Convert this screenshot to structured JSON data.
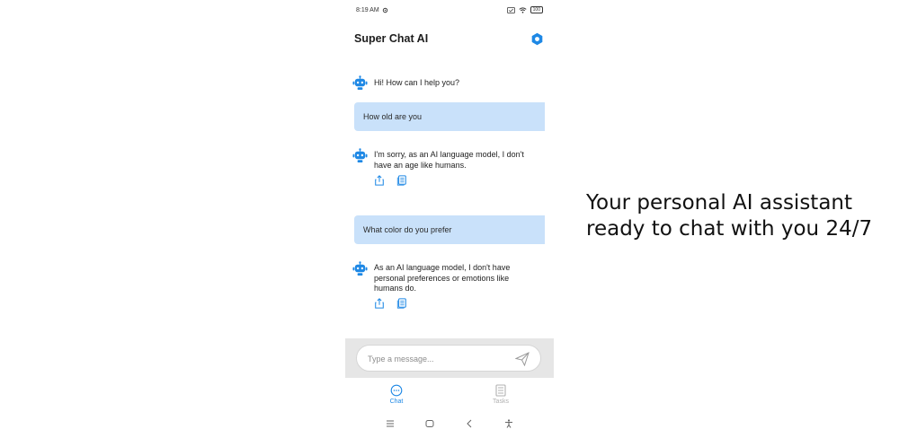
{
  "status_bar": {
    "time": "8:19 AM",
    "battery": "100"
  },
  "header": {
    "title": "Super Chat AI"
  },
  "messages": [
    {
      "role": "bot",
      "text": "Hi! How can I help you?"
    },
    {
      "role": "user",
      "text": "How old are you"
    },
    {
      "role": "bot",
      "text": "I'm sorry, as an AI language model, I don't have an age like humans."
    },
    {
      "role": "user",
      "text": "What color do you prefer"
    },
    {
      "role": "bot",
      "text": "As an AI language model, I don't have personal preferences or emotions like humans do."
    }
  ],
  "composer": {
    "placeholder": "Type a message..."
  },
  "bottom_nav": {
    "chat_label": "Chat",
    "tasks_label": "Tasks"
  },
  "promo": {
    "text": "Your personal AI assistant ready to chat with you 24/7"
  },
  "colors": {
    "accent": "#1e88e5",
    "user_bubble": "#c9e1fa",
    "composer_bg": "#e6e6e6"
  },
  "icons": [
    "settings-icon",
    "robot-icon",
    "share-icon",
    "copy-icon",
    "send-icon",
    "chat-icon",
    "tasks-icon"
  ]
}
